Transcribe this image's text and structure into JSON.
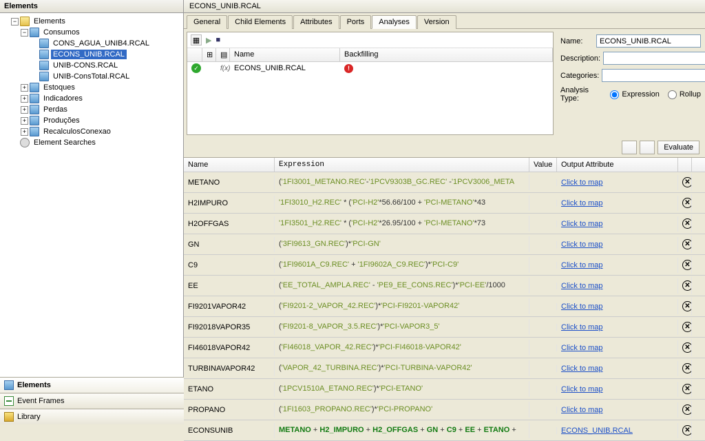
{
  "sidebar": {
    "title": "Elements",
    "root": "Elements",
    "consumos": "Consumos",
    "items": [
      "CONS_AGUA_UNIB4.RCAL",
      "ECONS_UNIB.RCAL",
      "UNIB-CONS.RCAL",
      "UNIB-ConsTotal.RCAL"
    ],
    "siblings": [
      "Estoques",
      "Indicadores",
      "Perdas",
      "Produções",
      "RecalculosConexao"
    ],
    "searches": "Element Searches",
    "nav": {
      "elements": "Elements",
      "eventframes": "Event Frames",
      "library": "Library"
    }
  },
  "main": {
    "title": "ECONS_UNIB.RCAL",
    "tabs": [
      "General",
      "Child Elements",
      "Attributes",
      "Ports",
      "Analyses",
      "Version"
    ],
    "analysis_header": {
      "name": "Name",
      "backfilling": "Backfilling"
    },
    "analysis_row_name": "ECONS_UNIB.RCAL",
    "props": {
      "name_label": "Name:",
      "name_value": "ECONS_UNIB.RCAL",
      "desc_label": "Description:",
      "desc_value": "",
      "cat_label": "Categories:",
      "cat_value": "",
      "atype_label": "Analysis Type:",
      "atype_expr": "Expression",
      "atype_rollup": "Rollup"
    },
    "evaluate": "Evaluate",
    "grid_header": {
      "name": "Name",
      "expr": "Expression",
      "value": "Value",
      "out": "Output Attribute"
    },
    "map_link": "Click to map",
    "rows": [
      {
        "name": "METANO",
        "expr": [
          [
            "op",
            "("
          ],
          [
            "str",
            "'1FI3001_METANO.REC'"
          ],
          [
            "op",
            "-"
          ],
          [
            "str",
            "'1PCV9303B_GC.REC'"
          ],
          [
            "op",
            " -"
          ],
          [
            "str",
            "'1PCV3006_META"
          ]
        ],
        "out_link": true
      },
      {
        "name": "H2IMPURO",
        "expr": [
          [
            "str",
            "'1FI3010_H2.REC'"
          ],
          [
            "op",
            " * ("
          ],
          [
            "str",
            "'PCI-H2'"
          ],
          [
            "op",
            "*56.66/100 + "
          ],
          [
            "str",
            "'PCI-METANO'"
          ],
          [
            "op",
            "*43"
          ]
        ],
        "out_link": true
      },
      {
        "name": "H2OFFGAS",
        "expr": [
          [
            "str",
            "'1FI3501_H2.REC'"
          ],
          [
            "op",
            " * ("
          ],
          [
            "str",
            "'PCI-H2'"
          ],
          [
            "op",
            "*26.95/100 + "
          ],
          [
            "str",
            "'PCI-METANO'"
          ],
          [
            "op",
            "*73"
          ]
        ],
        "out_link": true
      },
      {
        "name": "GN",
        "expr": [
          [
            "op",
            "("
          ],
          [
            "str",
            "'3FI9613_GN.REC'"
          ],
          [
            "op",
            ")*"
          ],
          [
            "str",
            "'PCI-GN'"
          ]
        ],
        "out_link": true
      },
      {
        "name": "C9",
        "expr": [
          [
            "op",
            "("
          ],
          [
            "str",
            "'1FI9601A_C9.REC'"
          ],
          [
            "op",
            " + "
          ],
          [
            "str",
            "'1FI9602A_C9.REC'"
          ],
          [
            "op",
            ")*"
          ],
          [
            "str",
            "'PCI-C9'"
          ]
        ],
        "out_link": true
      },
      {
        "name": "EE",
        "expr": [
          [
            "op",
            "("
          ],
          [
            "str",
            "'EE_TOTAL_AMPLA.REC'"
          ],
          [
            "op",
            " - "
          ],
          [
            "str",
            "'PE9_EE_CONS.REC'"
          ],
          [
            "op",
            ")*"
          ],
          [
            "str",
            "'PCI-EE'"
          ],
          [
            "op",
            "/1000"
          ]
        ],
        "out_link": true
      },
      {
        "name": "FI9201VAPOR42",
        "expr": [
          [
            "op",
            "("
          ],
          [
            "str",
            "'FI9201-2_VAPOR_42.REC'"
          ],
          [
            "op",
            ")*"
          ],
          [
            "str",
            "'PCI-FI9201-VAPOR42'"
          ]
        ],
        "out_link": true
      },
      {
        "name": "FI92018VAPOR35",
        "expr": [
          [
            "op",
            "("
          ],
          [
            "str",
            "'FI9201-8_VAPOR_3.5.REC'"
          ],
          [
            "op",
            ")*"
          ],
          [
            "str",
            "'PCI-VAPOR3_5'"
          ]
        ],
        "out_link": true
      },
      {
        "name": "FI46018VAPOR42",
        "expr": [
          [
            "op",
            "("
          ],
          [
            "str",
            "'FI46018_VAPOR_42.REC'"
          ],
          [
            "op",
            ")*"
          ],
          [
            "str",
            "'PCI-FI46018-VAPOR42'"
          ]
        ],
        "out_link": true
      },
      {
        "name": "TURBINAVAPOR42",
        "expr": [
          [
            "op",
            "("
          ],
          [
            "str",
            "'VAPOR_42_TURBINA.REC'"
          ],
          [
            "op",
            ")*"
          ],
          [
            "str",
            "'PCI-TURBINA-VAPOR42'"
          ]
        ],
        "out_link": true
      },
      {
        "name": "ETANO",
        "expr": [
          [
            "op",
            "("
          ],
          [
            "str",
            "'1PCV1510A_ETANO.REC'"
          ],
          [
            "op",
            ")*"
          ],
          [
            "str",
            "'PCI-ETANO'"
          ]
        ],
        "out_link": true
      },
      {
        "name": "PROPANO",
        "expr": [
          [
            "op",
            "("
          ],
          [
            "str",
            "'1FI1603_PROPANO.REC'"
          ],
          [
            "op",
            ")*"
          ],
          [
            "str",
            "'PCI-PROPANO'"
          ]
        ],
        "out_link": true
      },
      {
        "name": "ECONSUNIB",
        "expr": [
          [
            "var",
            "METANO"
          ],
          [
            "op",
            " + "
          ],
          [
            "var",
            "H2_IMPURO"
          ],
          [
            "op",
            " + "
          ],
          [
            "var",
            "H2_OFFGAS"
          ],
          [
            "op",
            " + "
          ],
          [
            "var",
            "GN"
          ],
          [
            "op",
            " + "
          ],
          [
            "var",
            "C9"
          ],
          [
            "op",
            " + "
          ],
          [
            "var",
            "EE"
          ],
          [
            "op",
            " + "
          ],
          [
            "var",
            "ETANO"
          ],
          [
            "op",
            " + "
          ]
        ],
        "out_attr": "ECONS_UNIB.RCAL"
      }
    ]
  }
}
